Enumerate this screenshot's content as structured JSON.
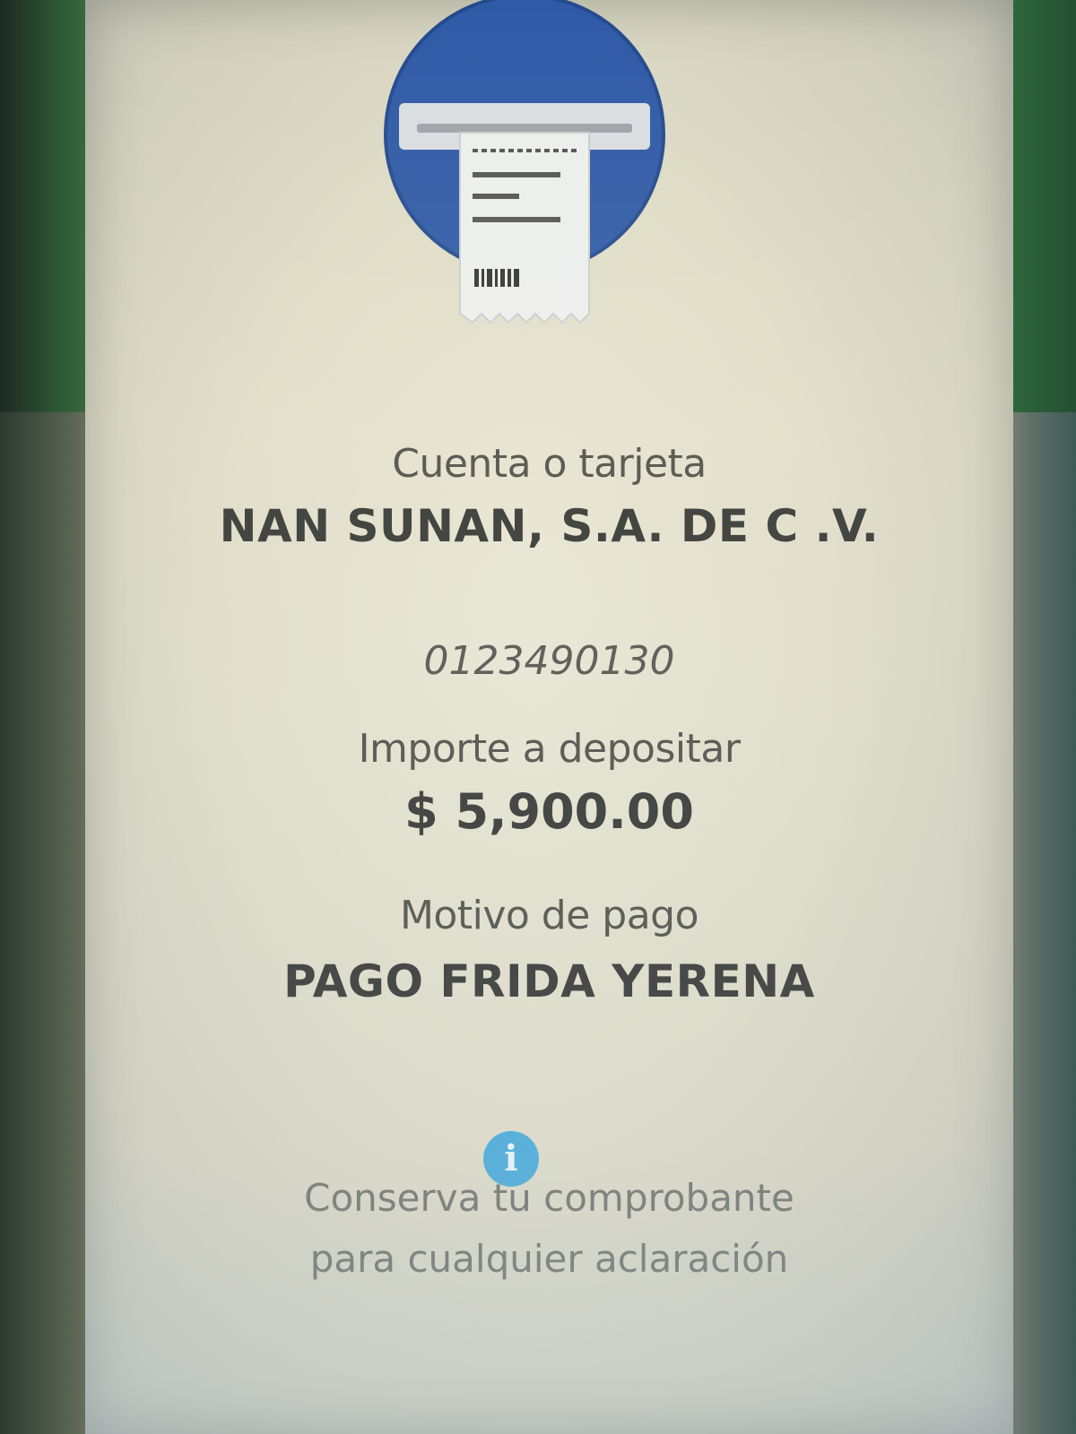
{
  "receipt": {
    "account_label": "Cuenta o tarjeta",
    "account_holder": "NAN SUNAN, S.A. DE C .V.",
    "account_number": "0123490130",
    "amount_label": "Importe a depositar",
    "amount_value": "$ 5,900.00",
    "reason_label": "Motivo de pago",
    "reason_value": "PAGO FRIDA YERENA",
    "info_icon": "info-icon",
    "info_glyph": "i",
    "note_line1": "Conserva tu comprobante",
    "note_line2": "para cualquier aclaración"
  },
  "colors": {
    "hero_circle": "#2f5aa6",
    "info_icon": "#3fa7d6",
    "screen_bg": "#e3e0cc"
  }
}
